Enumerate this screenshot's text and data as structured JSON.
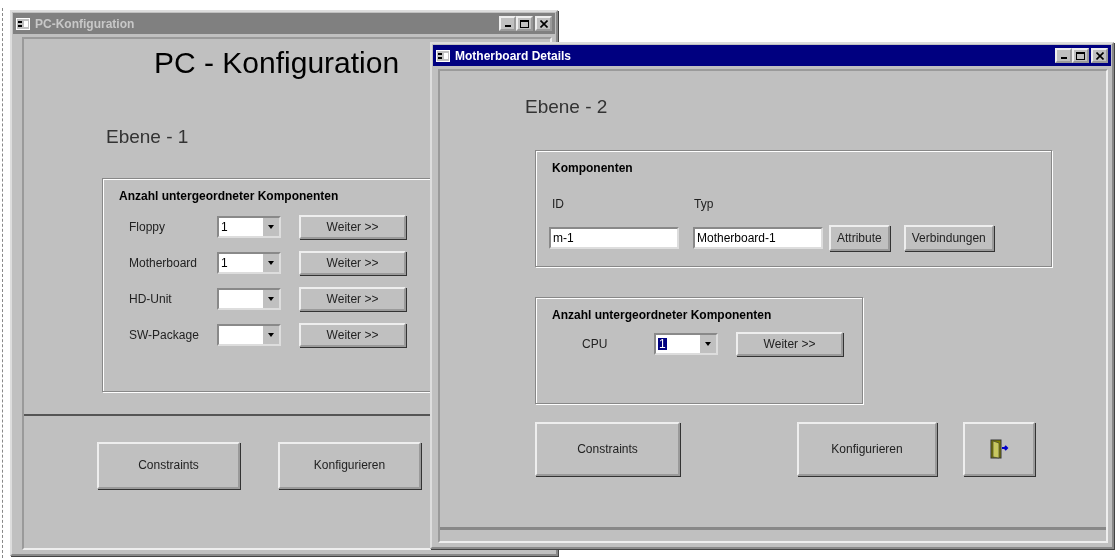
{
  "windows": [
    {
      "title": "PC-Konfiguration",
      "active": false,
      "heading": "PC - Konfiguration",
      "level_label": "Ebene - 1",
      "subcomponents": {
        "title": "Anzahl untergeordneter Komponenten",
        "rows": [
          {
            "label": "Floppy",
            "value": "1",
            "button": "Weiter >>"
          },
          {
            "label": "Motherboard",
            "value": "1",
            "button": "Weiter >>"
          },
          {
            "label": "HD-Unit",
            "button": "Weiter >>"
          },
          {
            "label": "SW-Package",
            "button": "Weiter >>"
          }
        ]
      },
      "buttons": [
        {
          "kind": "text",
          "label": "Constraints"
        },
        {
          "kind": "text",
          "label": "Konfigurieren"
        }
      ]
    },
    {
      "title": "Motherboard Details",
      "active": true,
      "level_label": "Ebene - 2",
      "components": {
        "title": "Komponenten",
        "fields": [
          {
            "label": "ID",
            "value": "m-1"
          },
          {
            "label": "Typ",
            "value": "Motherboard-1"
          }
        ],
        "buttons": [
          "Attribute",
          "Verbindungen"
        ]
      },
      "subcomponents": {
        "title": "Anzahl untergeordneter Komponenten",
        "rows": [
          {
            "label": "CPU",
            "value": "1",
            "text_selected": true,
            "button": "Weiter >>"
          }
        ]
      },
      "buttons": [
        {
          "kind": "text",
          "label": "Constraints"
        },
        {
          "kind": "text",
          "label": "Konfigurieren"
        },
        {
          "kind": "exit"
        }
      ]
    }
  ]
}
